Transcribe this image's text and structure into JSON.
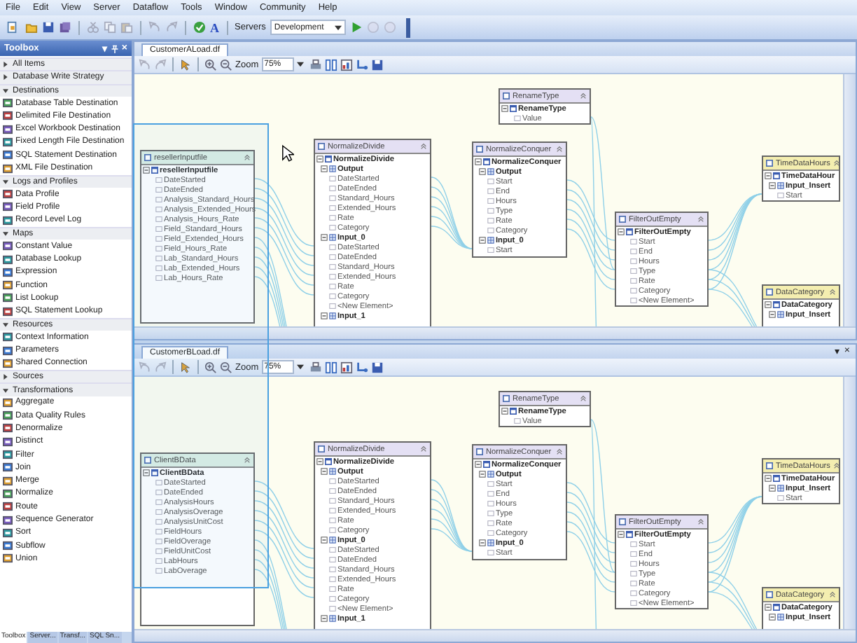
{
  "menu": [
    "File",
    "Edit",
    "View",
    "Server",
    "Dataflow",
    "Tools",
    "Window",
    "Community",
    "Help"
  ],
  "toolbar": {
    "font_glyph": "A",
    "servers_label": "Servers",
    "server_value": "Development"
  },
  "toolbox": {
    "title": "Toolbox",
    "controls": [
      "▾",
      "×"
    ],
    "groups": [
      {
        "label": "All Items",
        "expanded": false
      },
      {
        "label": "Database Write Strategy",
        "expanded": false
      },
      {
        "label": "Destinations",
        "expanded": true,
        "children": [
          "Database Table Destination",
          "Delimited File Destination",
          "Excel Workbook Destination",
          "Fixed Length File Destination",
          "SQL Statement Destination",
          "XML File Destination"
        ]
      },
      {
        "label": "Logs and Profiles",
        "expanded": true,
        "children": [
          "Data Profile",
          "Field Profile",
          "Record Level Log"
        ]
      },
      {
        "label": "Maps",
        "expanded": true,
        "children": [
          "Constant Value",
          "Database Lookup",
          "Expression",
          "Function",
          "List Lookup",
          "SQL Statement Lookup"
        ]
      },
      {
        "label": "Resources",
        "expanded": true,
        "children": [
          "Context Information",
          "Parameters",
          "Shared Connection"
        ]
      },
      {
        "label": "Sources",
        "expanded": false
      },
      {
        "label": "Transformations",
        "expanded": true,
        "children": [
          "Aggregate",
          "Data Quality Rules",
          "Denormalize",
          "Distinct",
          "Filter",
          "Join",
          "Merge",
          "Normalize",
          "Route",
          "Sequence Generator",
          "Sort",
          "Subflow",
          "Union"
        ]
      }
    ],
    "tabs": [
      {
        "label": "Toolbox",
        "selected": true
      },
      {
        "label": "Server...",
        "selected": false
      },
      {
        "label": "Transf...",
        "selected": false
      },
      {
        "label": "SQL Sn...",
        "selected": false
      }
    ]
  },
  "documents": [
    {
      "tab": "CustomerALoad.df",
      "zoom_label": "Zoom",
      "zoom": "75%",
      "nodes": [
        {
          "title": "resellerInputfile",
          "color": "#dcefe4",
          "rows": [
            {
              "kind": "root",
              "label": "resellerInputfile"
            },
            {
              "kind": "field",
              "label": "DateStarted"
            },
            {
              "kind": "field",
              "label": "DateEnded"
            },
            {
              "kind": "field",
              "label": "Analysis_Standard_Hours"
            },
            {
              "kind": "field",
              "label": "Analysis_Extended_Hours"
            },
            {
              "kind": "field",
              "label": "Analysis_Hours_Rate"
            },
            {
              "kind": "field",
              "label": "Field_Standard_Hours"
            },
            {
              "kind": "field",
              "label": "Field_Extended_Hours"
            },
            {
              "kind": "field",
              "label": "Field_Hours_Rate"
            },
            {
              "kind": "field",
              "label": "Lab_Standard_Hours"
            },
            {
              "kind": "field",
              "label": "Lab_Extended_Hours"
            },
            {
              "kind": "field",
              "label": "Lab_Hours_Rate"
            }
          ]
        },
        {
          "title": "NormalizeDivide",
          "color": "#e4e0f4",
          "rows": [
            {
              "kind": "root",
              "label": "NormalizeDivide"
            },
            {
              "kind": "group",
              "label": "Output"
            },
            {
              "kind": "field",
              "label": "DateStarted"
            },
            {
              "kind": "field",
              "label": "DateEnded"
            },
            {
              "kind": "field",
              "label": "Standard_Hours"
            },
            {
              "kind": "field",
              "label": "Extended_Hours"
            },
            {
              "kind": "field",
              "label": "Rate"
            },
            {
              "kind": "field",
              "label": "Category"
            },
            {
              "kind": "group",
              "label": "Input_0"
            },
            {
              "kind": "field",
              "label": "DateStarted"
            },
            {
              "kind": "field",
              "label": "DateEnded"
            },
            {
              "kind": "field",
              "label": "Standard_Hours"
            },
            {
              "kind": "field",
              "label": "Extended_Hours"
            },
            {
              "kind": "field",
              "label": "Rate"
            },
            {
              "kind": "field",
              "label": "Category"
            },
            {
              "kind": "field",
              "label": "<New Element>"
            },
            {
              "kind": "group",
              "label": "Input_1"
            }
          ]
        },
        {
          "title": "RenameType",
          "color": "#e4e0f4",
          "rows": [
            {
              "kind": "root",
              "label": "RenameType"
            },
            {
              "kind": "field",
              "label": "Value"
            }
          ]
        },
        {
          "title": "NormalizeConquer",
          "color": "#e4e0f4",
          "rows": [
            {
              "kind": "root",
              "label": "NormalizeConquer"
            },
            {
              "kind": "group",
              "label": "Output"
            },
            {
              "kind": "field",
              "label": "Start"
            },
            {
              "kind": "field",
              "label": "End"
            },
            {
              "kind": "field",
              "label": "Hours"
            },
            {
              "kind": "field",
              "label": "Type"
            },
            {
              "kind": "field",
              "label": "Rate"
            },
            {
              "kind": "field",
              "label": "Category"
            },
            {
              "kind": "group",
              "label": "Input_0"
            },
            {
              "kind": "field",
              "label": "Start"
            }
          ]
        },
        {
          "title": "FilterOutEmpty",
          "color": "#e4e0f4",
          "rows": [
            {
              "kind": "root",
              "label": "FilterOutEmpty"
            },
            {
              "kind": "field",
              "label": "Start"
            },
            {
              "kind": "field",
              "label": "End"
            },
            {
              "kind": "field",
              "label": "Hours"
            },
            {
              "kind": "field",
              "label": "Type"
            },
            {
              "kind": "field",
              "label": "Rate"
            },
            {
              "kind": "field",
              "label": "Category"
            },
            {
              "kind": "field",
              "label": "<New Element>"
            }
          ]
        },
        {
          "title": "TimeDataHours",
          "color": "#f4eeb0",
          "rows": [
            {
              "kind": "root",
              "label": "TimeDataHour"
            },
            {
              "kind": "group",
              "label": "Input_Insert"
            },
            {
              "kind": "field",
              "label": "Start"
            }
          ]
        },
        {
          "title": "DataCategory",
          "color": "#f4eeb0",
          "rows": [
            {
              "kind": "root",
              "label": "DataCategory"
            },
            {
              "kind": "group",
              "label": "Input_Insert"
            }
          ]
        }
      ]
    },
    {
      "tab": "CustomerBLoad.df",
      "zoom_label": "Zoom",
      "zoom": "75%",
      "window_controls": [
        "▾",
        "×"
      ],
      "nodes": [
        {
          "title": "ClientBData",
          "color": "#dcefe4",
          "rows": [
            {
              "kind": "root",
              "label": "ClientBData"
            },
            {
              "kind": "field",
              "label": "DateStarted"
            },
            {
              "kind": "field",
              "label": "DateEnded"
            },
            {
              "kind": "field",
              "label": "AnalysisHours"
            },
            {
              "kind": "field",
              "label": "AnalysisOverage"
            },
            {
              "kind": "field",
              "label": "AnalysisUnitCost"
            },
            {
              "kind": "field",
              "label": "FieldHours"
            },
            {
              "kind": "field",
              "label": "FieldOverage"
            },
            {
              "kind": "field",
              "label": "FieldUnitCost"
            },
            {
              "kind": "field",
              "label": "LabHours"
            },
            {
              "kind": "field",
              "label": "LabOverage"
            }
          ]
        },
        {
          "title": "NormalizeDivide",
          "color": "#e4e0f4",
          "rows": [
            {
              "kind": "root",
              "label": "NormalizeDivide"
            },
            {
              "kind": "group",
              "label": "Output"
            },
            {
              "kind": "field",
              "label": "DateStarted"
            },
            {
              "kind": "field",
              "label": "DateEnded"
            },
            {
              "kind": "field",
              "label": "Standard_Hours"
            },
            {
              "kind": "field",
              "label": "Extended_Hours"
            },
            {
              "kind": "field",
              "label": "Rate"
            },
            {
              "kind": "field",
              "label": "Category"
            },
            {
              "kind": "group",
              "label": "Input_0"
            },
            {
              "kind": "field",
              "label": "DateStarted"
            },
            {
              "kind": "field",
              "label": "DateEnded"
            },
            {
              "kind": "field",
              "label": "Standard_Hours"
            },
            {
              "kind": "field",
              "label": "Extended_Hours"
            },
            {
              "kind": "field",
              "label": "Rate"
            },
            {
              "kind": "field",
              "label": "Category"
            },
            {
              "kind": "field",
              "label": "<New Element>"
            },
            {
              "kind": "group",
              "label": "Input_1"
            }
          ]
        },
        {
          "title": "RenameType",
          "color": "#e4e0f4",
          "rows": [
            {
              "kind": "root",
              "label": "RenameType"
            },
            {
              "kind": "field",
              "label": "Value"
            }
          ]
        },
        {
          "title": "NormalizeConquer",
          "color": "#e4e0f4",
          "rows": [
            {
              "kind": "root",
              "label": "NormalizeConquer"
            },
            {
              "kind": "group",
              "label": "Output"
            },
            {
              "kind": "field",
              "label": "Start"
            },
            {
              "kind": "field",
              "label": "End"
            },
            {
              "kind": "field",
              "label": "Hours"
            },
            {
              "kind": "field",
              "label": "Type"
            },
            {
              "kind": "field",
              "label": "Rate"
            },
            {
              "kind": "field",
              "label": "Category"
            },
            {
              "kind": "group",
              "label": "Input_0"
            },
            {
              "kind": "field",
              "label": "Start"
            }
          ]
        },
        {
          "title": "FilterOutEmpty",
          "color": "#e4e0f4",
          "rows": [
            {
              "kind": "root",
              "label": "FilterOutEmpty"
            },
            {
              "kind": "field",
              "label": "Start"
            },
            {
              "kind": "field",
              "label": "End"
            },
            {
              "kind": "field",
              "label": "Hours"
            },
            {
              "kind": "field",
              "label": "Type"
            },
            {
              "kind": "field",
              "label": "Rate"
            },
            {
              "kind": "field",
              "label": "Category"
            },
            {
              "kind": "field",
              "label": "<New Element>"
            }
          ]
        },
        {
          "title": "TimeDataHours",
          "color": "#f4eeb0",
          "rows": [
            {
              "kind": "root",
              "label": "TimeDataHour"
            },
            {
              "kind": "group",
              "label": "Input_Insert"
            },
            {
              "kind": "field",
              "label": "Start"
            }
          ]
        },
        {
          "title": "DataCategory",
          "color": "#f4eeb0",
          "rows": [
            {
              "kind": "root",
              "label": "DataCategory"
            },
            {
              "kind": "group",
              "label": "Input_Insert"
            }
          ]
        }
      ]
    }
  ]
}
